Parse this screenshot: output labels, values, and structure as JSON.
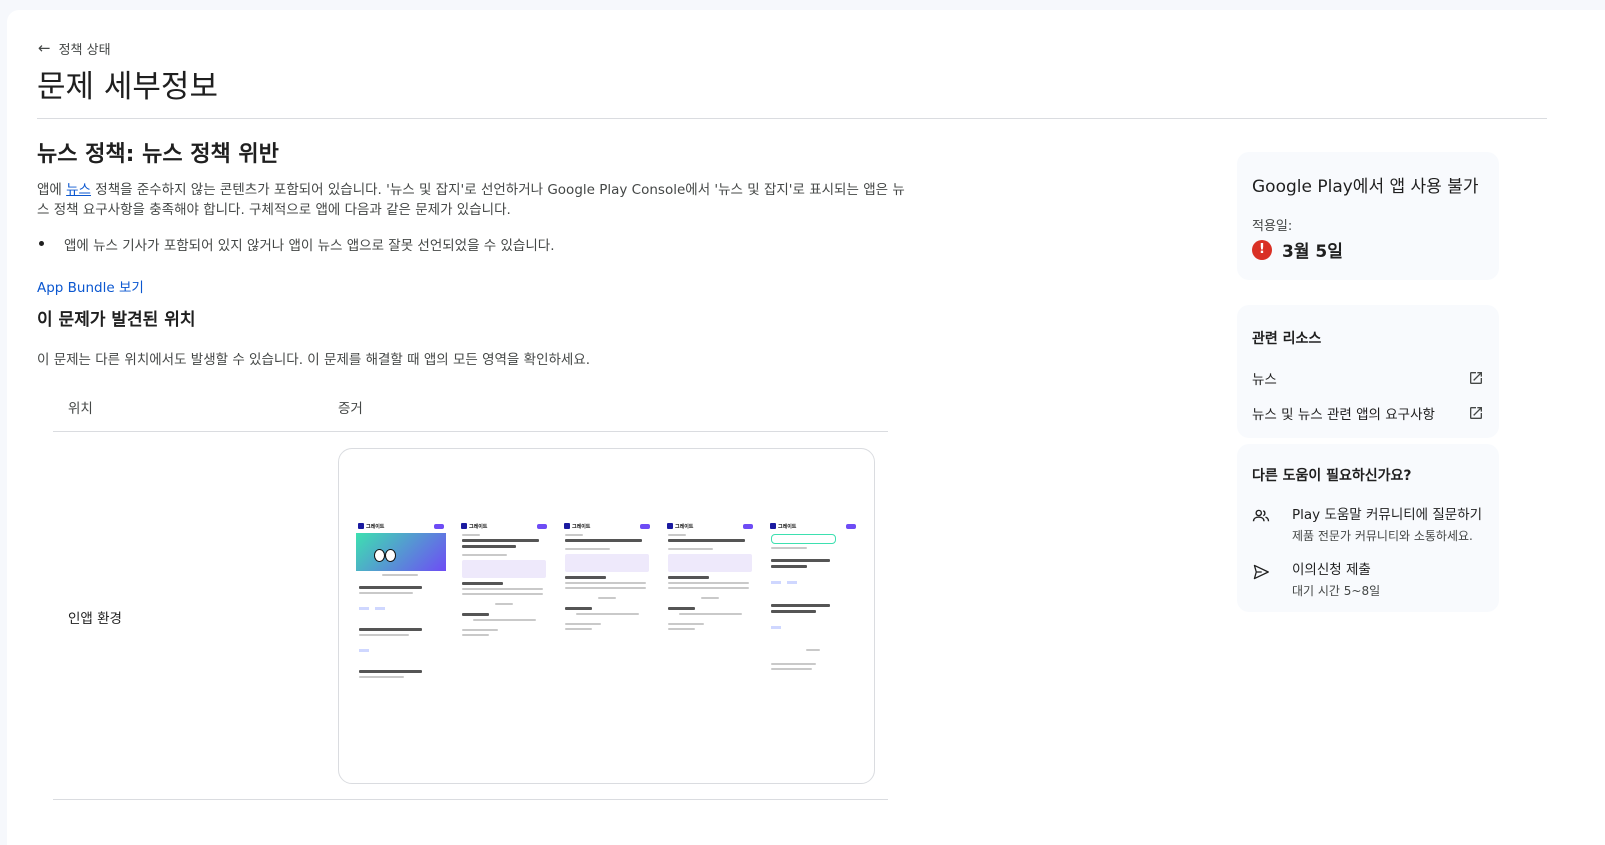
{
  "nav": {
    "back_label": "정책 상태"
  },
  "page": {
    "title": "문제 세부정보"
  },
  "issue": {
    "title": "뉴스 정책: 뉴스 정책 위반",
    "desc_prefix": "앱에 ",
    "desc_link": "뉴스",
    "desc_suffix": " 정책을 준수하지 않는 콘텐츠가 포함되어 있습니다. '뉴스 및 잡지'로 선언하거나 Google Play Console에서 '뉴스 및 잡지'로 표시되는 앱은 뉴스 정책 요구사항을 충족해야 합니다. 구체적으로 앱에 다음과 같은 문제가 있습니다.",
    "bullet": "앱에 뉴스 기사가 포함되어 있지 않거나 앱이 뉴스 앱으로 잘못 선언되었을 수 있습니다.",
    "bundle_link": "App Bundle 보기"
  },
  "location": {
    "title": "이 문제가 발견된 위치",
    "desc": "이 문제는 다른 위치에서도 발생할 수 있습니다. 이 문제를 해결할 때 앱의 모든 영역을 확인하세요.",
    "col_location": "위치",
    "col_evidence": "증거",
    "row_location": "인앱 환경",
    "screenshot_app_name": "그레이트"
  },
  "status_card": {
    "title": "Google Play에서 앱 사용 불가",
    "applied_label": "적용일:",
    "applied_date": "3월 5일"
  },
  "resources": {
    "title": "관련 리소스",
    "items": [
      {
        "label": "뉴스"
      },
      {
        "label": "뉴스 및 뉴스 관련 앱의 요구사항"
      }
    ]
  },
  "help": {
    "title": "다른 도움이 필요하신가요?",
    "community_title": "Play 도움말 커뮤니티에 질문하기",
    "community_sub": "제품 전문가 커뮤니티와 소통하세요.",
    "appeal_title": "이의신청 제출",
    "appeal_sub": "대기 시간 5~8일"
  },
  "colors": {
    "accent": "#0b57d0",
    "error": "#d93025",
    "card_bg": "#f8fafd"
  }
}
